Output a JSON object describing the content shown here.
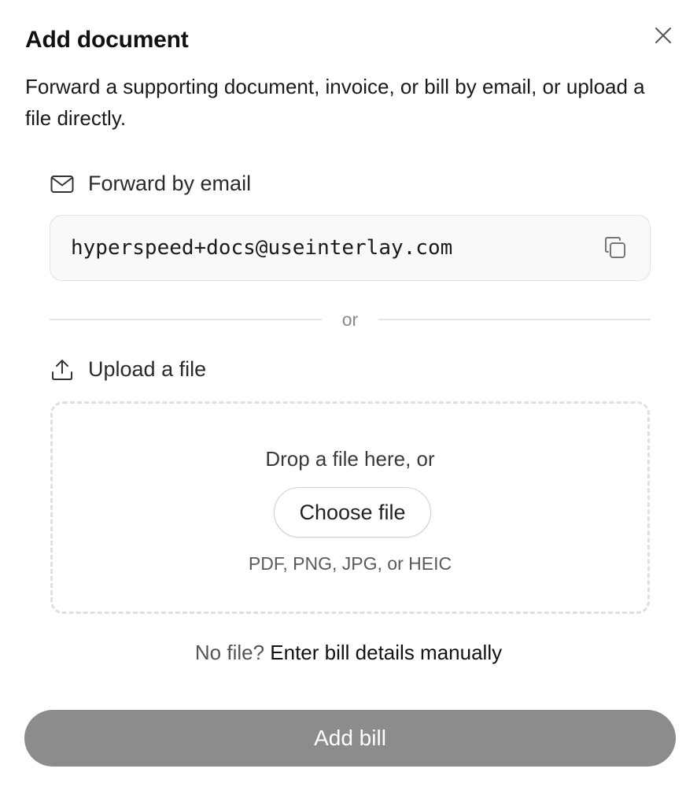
{
  "dialog": {
    "title": "Add document",
    "description": "Forward a supporting document, invoice, or bill by email, or upload a file directly."
  },
  "email_section": {
    "icon": "mail-icon",
    "label": "Forward by email",
    "address": "hyperspeed+docs@useinterlay.com",
    "copy_icon": "copy-icon"
  },
  "divider": {
    "label": "or"
  },
  "upload_section": {
    "icon": "upload-icon",
    "label": "Upload a file",
    "drop_text": "Drop a file here, or",
    "choose_button": "Choose file",
    "formats": "PDF, PNG, JPG, or HEIC"
  },
  "manual": {
    "prefix": "No file?",
    "link": "Enter bill details manually"
  },
  "footer": {
    "submit_label": "Add bill",
    "submit_color": "#8c8c8c"
  }
}
